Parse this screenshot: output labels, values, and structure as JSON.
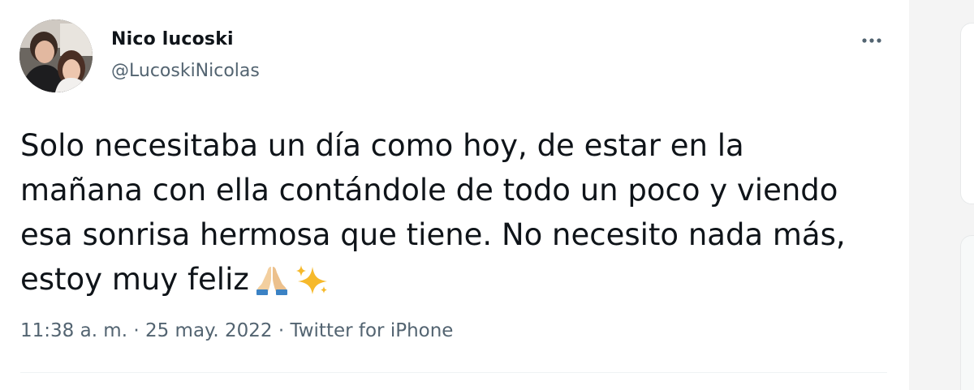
{
  "tweet": {
    "display_name": "Nico lucoski",
    "handle": "@LucoskiNicolas",
    "text_lines": [
      "Solo necesitaba un día como hoy, de estar en la",
      "mañana con ella contándole de todo un poco y viendo",
      "esa sonrisa hermosa que tiene. No necesito nada más,",
      "estoy muy feliz"
    ],
    "emojis": [
      "folded-hands-icon",
      "sparkles-icon"
    ],
    "time": "11:38 a. m.",
    "separator": " · ",
    "date": "25 may. 2022",
    "source": "Twitter for iPhone"
  },
  "icons": {
    "more": "more-options-icon"
  },
  "colors": {
    "text": "#0f1419",
    "secondary": "#536471",
    "divider": "#eff3f4"
  }
}
